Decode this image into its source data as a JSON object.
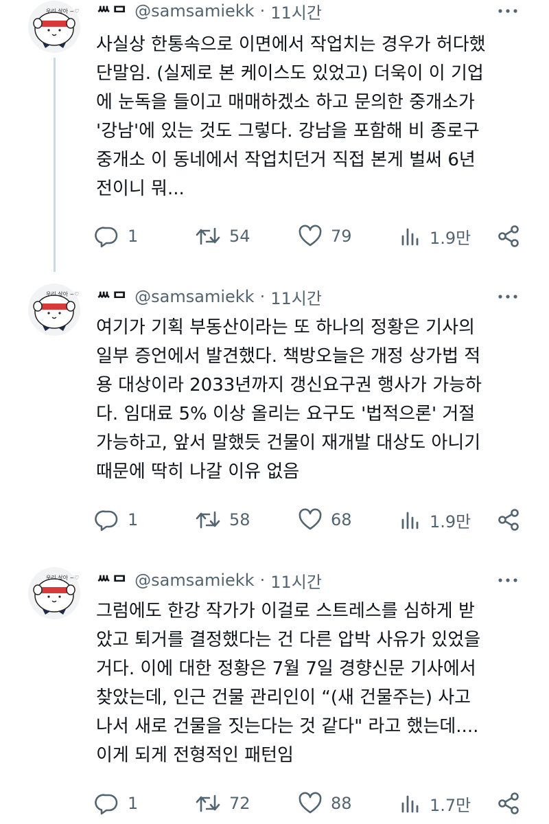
{
  "tweets": [
    {
      "name": "ᄴᄆ",
      "handle": "@samsamiekk",
      "separator": "·",
      "time": "11시간",
      "text_lines": [
        "사실상 한통속으로 이면에서 작업치는 경우가 허다했",
        "단말임. (실제로 본 케이스도 있었고) 더욱이 이 기업",
        "에 눈독을 들이고 매매하겠소 하고 문의한 중개소가",
        "'강남'에 있는 것도 그렇다. 강남을 포함해 비 종로구",
        "중개소 이 동네에서 작업치던거 직접 본게 벌써 6년",
        "전이니 뭐..."
      ],
      "replies": "1",
      "retweets": "54",
      "likes": "79",
      "views": "1.9만"
    },
    {
      "name": "ᄴᄆ",
      "handle": "@samsamiekk",
      "separator": "·",
      "time": "11시간",
      "text_lines": [
        "여기가 기획 부동산이라는 또 하나의 정황은 기사의",
        "일부 증언에서 발견했다. 책방오늘은 개정 상가법 적",
        "용 대상이라 2033년까지 갱신요구권 행사가 가능하",
        "다. 임대료 5% 이상 올리는 요구도 '법적으론' 거절",
        "가능하고, 앞서 말했듯 건물이 재개발 대상도 아니기",
        "때문에 딱히 나갈 이유 없음"
      ],
      "replies": "1",
      "retweets": "58",
      "likes": "68",
      "views": "1.9만"
    },
    {
      "name": "ᄴᄆ",
      "handle": "@samsamiekk",
      "separator": "·",
      "time": "11시간",
      "text_lines": [
        "그럼에도 한강 작가가 이걸로 스트레스를 심하게 받",
        "았고 퇴거를 결정했다는 건 다른 압박 사유가 있었을",
        "거다. 이에 대한 정황은 7월 7일 경향신문 기사에서",
        "찾았는데, 인근 건물 관리인이 “(새 건물주는) 사고",
        "나서 새로 건물을 짓는다는 것 같다\" 라고 했는데....",
        "이게 되게 전형적인 패턴임"
      ],
      "replies": "1",
      "retweets": "72",
      "likes": "88",
      "views": "1.7만"
    }
  ],
  "icons": {
    "more": "more-icon",
    "reply": "reply-icon",
    "retweet": "retweet-icon",
    "like": "heart-icon",
    "views": "views-icon",
    "share": "share-icon"
  },
  "colors": {
    "text": "#0f1419",
    "secondary": "#536471",
    "thread_line": "#cfd9de",
    "avatar_band": "#d83a3a"
  }
}
